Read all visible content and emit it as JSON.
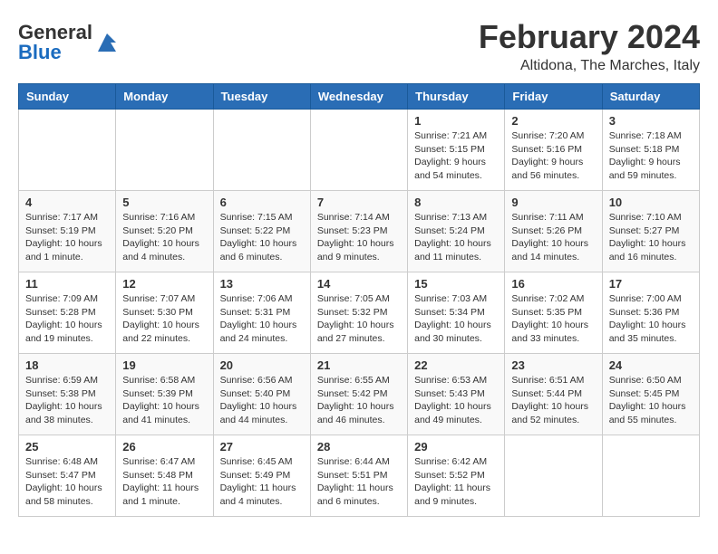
{
  "header": {
    "logo_general": "General",
    "logo_blue": "Blue",
    "month_title": "February 2024",
    "location": "Altidona, The Marches, Italy"
  },
  "weekdays": [
    "Sunday",
    "Monday",
    "Tuesday",
    "Wednesday",
    "Thursday",
    "Friday",
    "Saturday"
  ],
  "weeks": [
    [
      {
        "day": "",
        "info": ""
      },
      {
        "day": "",
        "info": ""
      },
      {
        "day": "",
        "info": ""
      },
      {
        "day": "",
        "info": ""
      },
      {
        "day": "1",
        "info": "Sunrise: 7:21 AM\nSunset: 5:15 PM\nDaylight: 9 hours and 54 minutes."
      },
      {
        "day": "2",
        "info": "Sunrise: 7:20 AM\nSunset: 5:16 PM\nDaylight: 9 hours and 56 minutes."
      },
      {
        "day": "3",
        "info": "Sunrise: 7:18 AM\nSunset: 5:18 PM\nDaylight: 9 hours and 59 minutes."
      }
    ],
    [
      {
        "day": "4",
        "info": "Sunrise: 7:17 AM\nSunset: 5:19 PM\nDaylight: 10 hours and 1 minute."
      },
      {
        "day": "5",
        "info": "Sunrise: 7:16 AM\nSunset: 5:20 PM\nDaylight: 10 hours and 4 minutes."
      },
      {
        "day": "6",
        "info": "Sunrise: 7:15 AM\nSunset: 5:22 PM\nDaylight: 10 hours and 6 minutes."
      },
      {
        "day": "7",
        "info": "Sunrise: 7:14 AM\nSunset: 5:23 PM\nDaylight: 10 hours and 9 minutes."
      },
      {
        "day": "8",
        "info": "Sunrise: 7:13 AM\nSunset: 5:24 PM\nDaylight: 10 hours and 11 minutes."
      },
      {
        "day": "9",
        "info": "Sunrise: 7:11 AM\nSunset: 5:26 PM\nDaylight: 10 hours and 14 minutes."
      },
      {
        "day": "10",
        "info": "Sunrise: 7:10 AM\nSunset: 5:27 PM\nDaylight: 10 hours and 16 minutes."
      }
    ],
    [
      {
        "day": "11",
        "info": "Sunrise: 7:09 AM\nSunset: 5:28 PM\nDaylight: 10 hours and 19 minutes."
      },
      {
        "day": "12",
        "info": "Sunrise: 7:07 AM\nSunset: 5:30 PM\nDaylight: 10 hours and 22 minutes."
      },
      {
        "day": "13",
        "info": "Sunrise: 7:06 AM\nSunset: 5:31 PM\nDaylight: 10 hours and 24 minutes."
      },
      {
        "day": "14",
        "info": "Sunrise: 7:05 AM\nSunset: 5:32 PM\nDaylight: 10 hours and 27 minutes."
      },
      {
        "day": "15",
        "info": "Sunrise: 7:03 AM\nSunset: 5:34 PM\nDaylight: 10 hours and 30 minutes."
      },
      {
        "day": "16",
        "info": "Sunrise: 7:02 AM\nSunset: 5:35 PM\nDaylight: 10 hours and 33 minutes."
      },
      {
        "day": "17",
        "info": "Sunrise: 7:00 AM\nSunset: 5:36 PM\nDaylight: 10 hours and 35 minutes."
      }
    ],
    [
      {
        "day": "18",
        "info": "Sunrise: 6:59 AM\nSunset: 5:38 PM\nDaylight: 10 hours and 38 minutes."
      },
      {
        "day": "19",
        "info": "Sunrise: 6:58 AM\nSunset: 5:39 PM\nDaylight: 10 hours and 41 minutes."
      },
      {
        "day": "20",
        "info": "Sunrise: 6:56 AM\nSunset: 5:40 PM\nDaylight: 10 hours and 44 minutes."
      },
      {
        "day": "21",
        "info": "Sunrise: 6:55 AM\nSunset: 5:42 PM\nDaylight: 10 hours and 46 minutes."
      },
      {
        "day": "22",
        "info": "Sunrise: 6:53 AM\nSunset: 5:43 PM\nDaylight: 10 hours and 49 minutes."
      },
      {
        "day": "23",
        "info": "Sunrise: 6:51 AM\nSunset: 5:44 PM\nDaylight: 10 hours and 52 minutes."
      },
      {
        "day": "24",
        "info": "Sunrise: 6:50 AM\nSunset: 5:45 PM\nDaylight: 10 hours and 55 minutes."
      }
    ],
    [
      {
        "day": "25",
        "info": "Sunrise: 6:48 AM\nSunset: 5:47 PM\nDaylight: 10 hours and 58 minutes."
      },
      {
        "day": "26",
        "info": "Sunrise: 6:47 AM\nSunset: 5:48 PM\nDaylight: 11 hours and 1 minute."
      },
      {
        "day": "27",
        "info": "Sunrise: 6:45 AM\nSunset: 5:49 PM\nDaylight: 11 hours and 4 minutes."
      },
      {
        "day": "28",
        "info": "Sunrise: 6:44 AM\nSunset: 5:51 PM\nDaylight: 11 hours and 6 minutes."
      },
      {
        "day": "29",
        "info": "Sunrise: 6:42 AM\nSunset: 5:52 PM\nDaylight: 11 hours and 9 minutes."
      },
      {
        "day": "",
        "info": ""
      },
      {
        "day": "",
        "info": ""
      }
    ]
  ]
}
